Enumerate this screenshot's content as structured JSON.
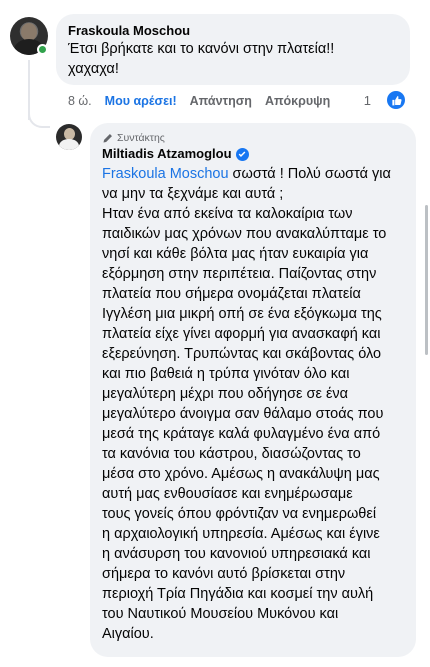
{
  "comment1": {
    "author": "Fraskoula Moschou",
    "line1": "Έτσι βρήκατε και το κανόνι στην πλατεία!!",
    "line2": "χαχαχα!",
    "time": "8 ώ.",
    "liked_label": "Μου αρέσει!",
    "reply_label": "Απάντηση",
    "hide_label": "Απόκρυψη",
    "reaction_count": "1",
    "colors": {
      "like_blue": "#1877f2",
      "online_green": "#31a24c",
      "bubble": "#f0f2f5"
    }
  },
  "reply": {
    "role": "Συντάκτης",
    "author": "Miltiadis Atzamoglou",
    "mention": "Fraskoula Moschou",
    "lines": [
      " σωστά ! Πολύ σωστά για",
      "να μην τα ξεχνάμε και αυτά ;",
      "Ηταν ένα από εκείνα τα καλοκαίρια των",
      "παιδικών μας χρόνων που ανακαλύπταμε το",
      "νησί και κάθε βόλτα μας ήταν ευκαιρία για",
      "εξόρμηση στην περιπέτεια. Παίζοντας στην",
      "πλατεία που σήμερα ονομάζεται πλατεία",
      "Ιγγλέση μια μικρή οπή σε ένα εξόγκωμα της",
      "πλατεία είχε γίνει αφορμή για ανασκαφή και",
      "εξερεύνηση.  Τρυπώντας και σκάβοντας όλο",
      "και πιο βαθειά η τρύπα γινόταν όλο και",
      "μεγαλύτερη μέχρι που οδήγησε σε ένα",
      "μεγαλύτερο άνοιγμα σαν θάλαμο στοάς που",
      "μεσά της κράταγε καλά φυλαγμένο ένα από",
      "τα κανόνια του κάστρου, διασώζοντας το",
      "μέσα στο χρόνο. Αμέσως η ανακάλυψη μας",
      "αυτή μας ενθουσίασε και ενημέρωσαμε",
      "τους γονείς όπου φρόντιζαν να ενημερωθεί",
      "η αρχαιολογική υπηρεσία. Αμέσως και έγινε",
      "η ανάσυρση του κανονιού υπηρεσιακά και",
      "σήμερα το κανόνι αυτό βρίσκεται στην",
      "περιοχή Τρία Πηγάδια και κοσμεί την αυλή",
      "του Ναυτικού Μουσείου Μυκόνου και",
      "Αιγαίου."
    ]
  }
}
